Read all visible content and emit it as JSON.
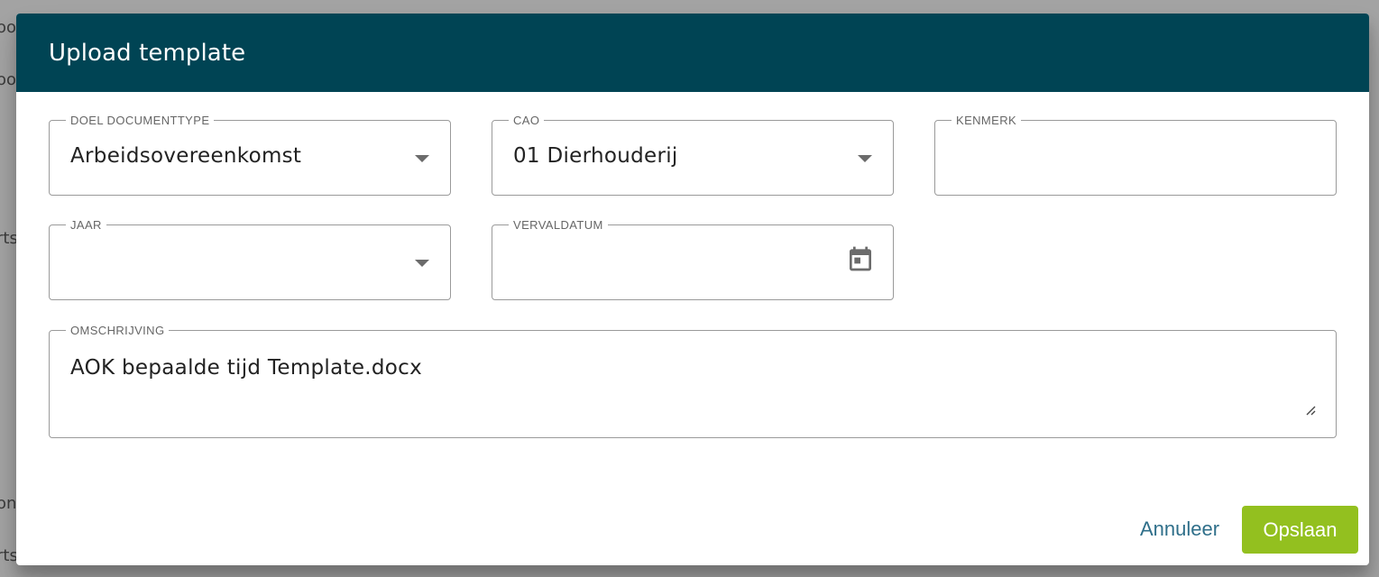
{
  "background": {
    "fragments": [
      "oo",
      "oo",
      "rts",
      "on",
      "rts"
    ]
  },
  "dialog": {
    "title": "Upload template"
  },
  "fields": {
    "doel_documenttype": {
      "label": "DOEL DOCUMENTTYPE",
      "value": "Arbeidsovereenkomst",
      "icon": "dropdown-arrow-icon"
    },
    "cao": {
      "label": "CAO",
      "value": "01 Dierhouderij",
      "icon": "dropdown-arrow-icon"
    },
    "kenmerk": {
      "label": "KENMERK",
      "value": ""
    },
    "jaar": {
      "label": "JAAR",
      "value": "",
      "icon": "dropdown-arrow-icon"
    },
    "vervaldatum": {
      "label": "VERVALDATUM",
      "value": "",
      "icon": "calendar-icon"
    },
    "omschrijving": {
      "label": "OMSCHRIJVING",
      "value": "AOK bepaalde tijd Template.docx",
      "icon": "resize-handle-icon"
    }
  },
  "actions": {
    "cancel_label": "Annuleer",
    "save_label": "Opslaan"
  },
  "colors": {
    "header": "#004454",
    "primary_button": "#93c01f",
    "link": "#2f6f8a",
    "overlay": "#a3a3a3"
  }
}
